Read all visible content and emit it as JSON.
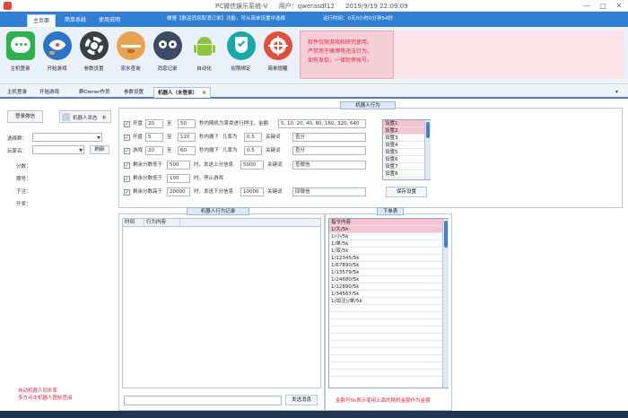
{
  "window": {
    "title": "PC微信娱乐系统-V",
    "user": "用户：qwerasdf12",
    "datetime": "2019/9/19 22:09:09",
    "minimize": "—",
    "maximize": "□",
    "close": "✕"
  },
  "top_tabs": [
    {
      "label": "主页面"
    },
    {
      "label": "简单系统"
    },
    {
      "label": "使用说明"
    }
  ],
  "notice": "做慢【数运消息取消订单】功能，可从简单设置中选择",
  "countdown": "运行时间：0天0小时0分钟54秒",
  "ribbon": {
    "items": [
      {
        "label": "主机登录",
        "icon": "chat-bubble-icon"
      },
      {
        "label": "开始游戏",
        "icon": "rocket-icon"
      },
      {
        "label": "参数设置",
        "icon": "gear-icon"
      },
      {
        "label": "流水查询",
        "icon": "bear-icon"
      },
      {
        "label": "消息记录",
        "icon": "owl-icon"
      },
      {
        "label": "自动化",
        "icon": "android-icon"
      },
      {
        "label": "权限绑定",
        "icon": "shield-check-icon"
      },
      {
        "label": "简单提醒",
        "icon": "pinwheel-icon"
      }
    ],
    "warning_lines": [
      "软件仅限游戏和研究使用。",
      "严禁用于赌博等违法行为。",
      "如有发现，一律封停账号。"
    ]
  },
  "sub_tabs": [
    {
      "label": "主机登录"
    },
    {
      "label": "开始游戏"
    },
    {
      "label": "群Owner作员"
    },
    {
      "label": "参数设置"
    },
    {
      "label": "机器人（未登录）",
      "close": "×"
    }
  ],
  "left": {
    "login_btn": "登录微信",
    "robot_label": "机器人状态",
    "robot_toggle": "卡",
    "group_label": "选择群：",
    "member_label": "玩家名：",
    "refresh_btn": "刷新",
    "stats": [
      "分数：",
      "期号：",
      "下注：",
      "开奖："
    ],
    "red_notes": [
      "自动机器人同步率",
      "多方点击机器人图标查阅"
    ]
  },
  "settings": {
    "title": "机器人行为",
    "rows": [
      {
        "checked": true,
        "label1": "开盘",
        "v1": "20",
        "mid": "至",
        "v2": "50",
        "text": "秒内随机为某类进行押注，金额",
        "value": "5, 10, 20, 40, 80, 160, 320, 640"
      },
      {
        "checked": true,
        "label1": "开盘",
        "v1": "5",
        "mid": "至",
        "v2": "120",
        "text": "秒内撤下",
        "text2": "几率为",
        "ratio": "0.5",
        "text3": "关键词",
        "value": "查分"
      },
      {
        "checked": true,
        "label1": "游戏",
        "v1": "20",
        "mid": "至",
        "v2": "60",
        "text": "秒内撤下",
        "text2": "几率为",
        "ratio": "0.5",
        "text3": "关键词",
        "value": "查分"
      },
      {
        "checked": true,
        "label1": "剩余分数低于",
        "v1": "500",
        "text": "时，发送上分信息",
        "ratio": "5000",
        "text3": "关键词",
        "value": "查微信"
      },
      {
        "checked": true,
        "label1": "剩余分数低于",
        "v1": "100",
        "text": "时，停止游戏"
      },
      {
        "checked": true,
        "label1": "剩余分数高于",
        "v1": "20000",
        "text": "时，发送下分信息",
        "ratio": "10000",
        "text3": "关键词",
        "value": "回微信"
      }
    ],
    "robot_list": [
      "设置1",
      "设置2",
      "设置3",
      "设置4",
      "设置5",
      "设置6",
      "设置7",
      "设置8"
    ],
    "save_btn": "保存设置"
  },
  "records": {
    "title": "机器人行为记录",
    "columns": [
      "时间",
      "行为内容"
    ],
    "send_btn": "发送消息"
  },
  "bet_table": {
    "title": "下单表",
    "header": "指令内容",
    "rows": [
      "1/大/5k",
      "1/小/5k",
      "1/单/5k",
      "1/双/5k",
      "1/12345/5k",
      "1/67890/5k",
      "1/13579/5k",
      "1/24680/5k",
      "1/12890/5k",
      "1/34567/5k",
      "1(加注)/单/5k"
    ],
    "note": "金额写5k表示使用上面的随机金额作为金额"
  }
}
